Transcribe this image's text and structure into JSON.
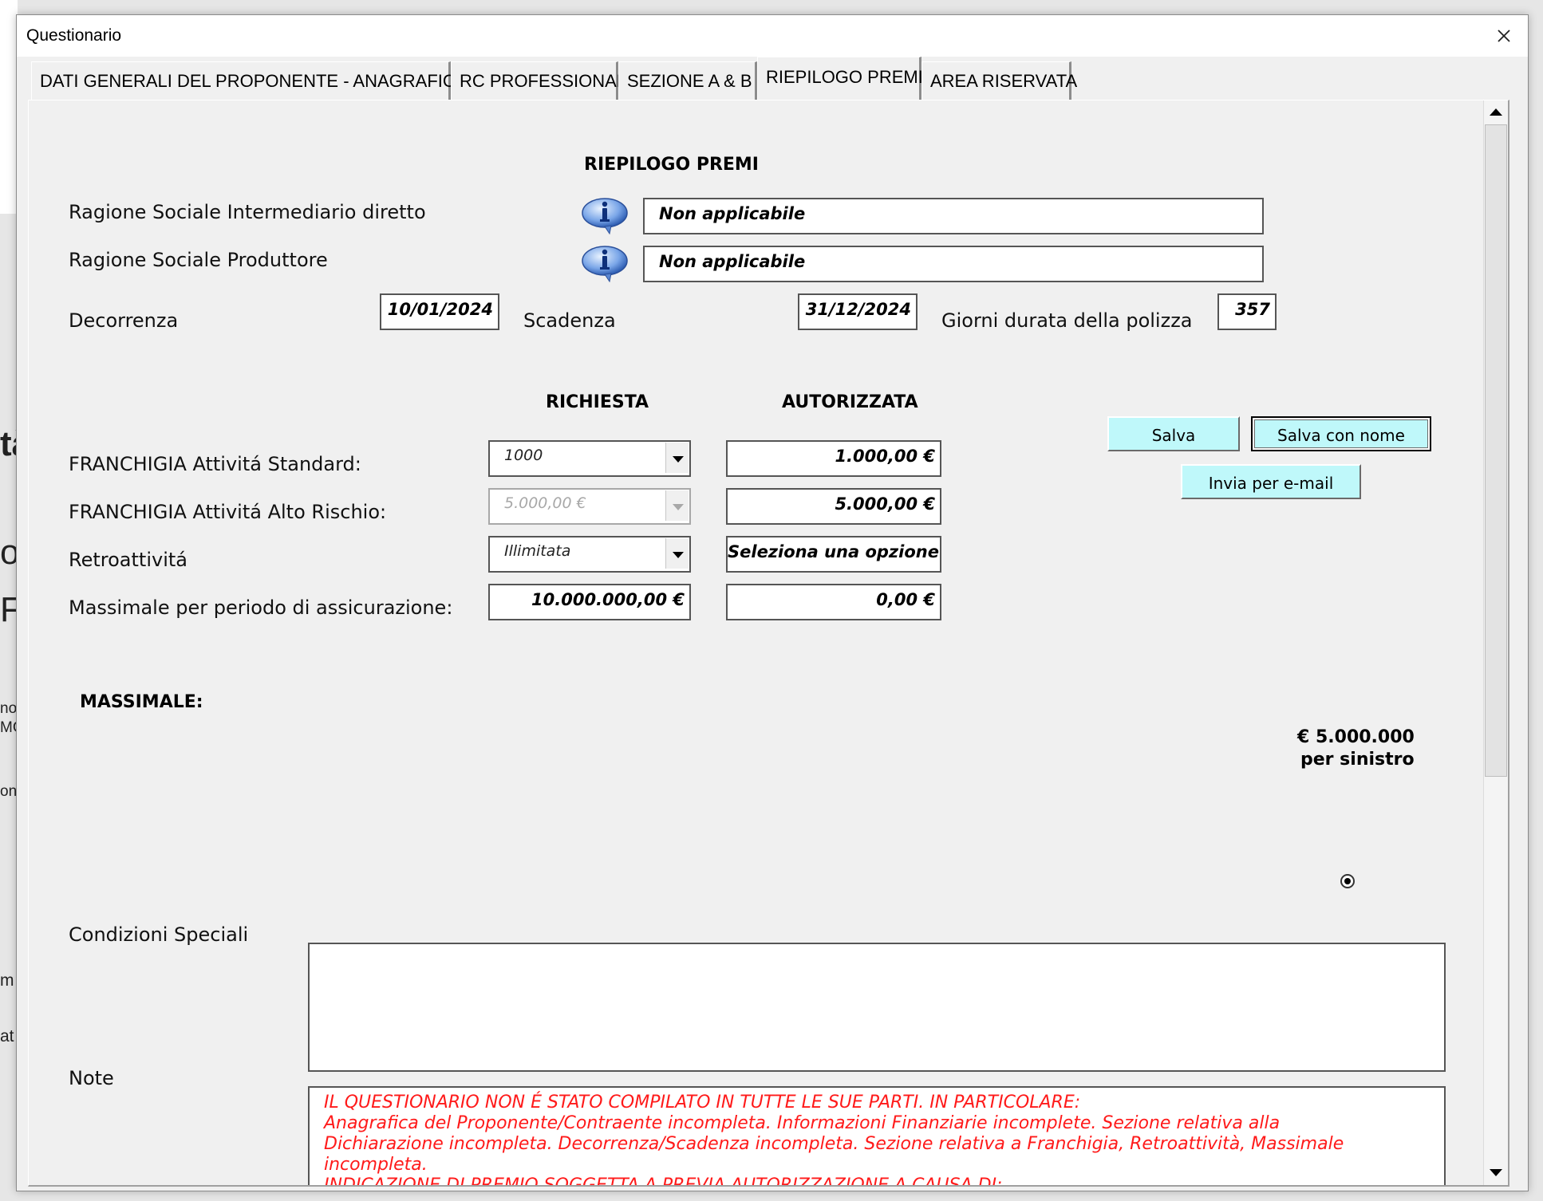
{
  "window": {
    "title": "Questionario"
  },
  "tabs": [
    {
      "label": "DATI GENERALI DEL PROPONENTE - ANAGRAFICA"
    },
    {
      "label": "RC PROFESSIONALE"
    },
    {
      "label": "SEZIONE A & B"
    },
    {
      "label": "RIEPILOGO PREMI",
      "active": true
    },
    {
      "label": "AREA RISERVATA"
    }
  ],
  "page": {
    "heading": "RIEPILOGO PREMI",
    "ragione_intermediario": {
      "label": "Ragione Sociale Intermediario diretto",
      "value": "Non applicabile"
    },
    "ragione_produttore": {
      "label": "Ragione Sociale Produttore",
      "value": "Non applicabile"
    },
    "decorrenza": {
      "label": "Decorrenza",
      "value": "10/01/2024"
    },
    "scadenza": {
      "label": "Scadenza",
      "value": "31/12/2024"
    },
    "giorni": {
      "label": "Giorni durata della polizza",
      "value": "357"
    },
    "col_richiesta": "RICHIESTA",
    "col_autorizzata": "AUTORIZZATA",
    "rows": [
      {
        "label": "FRANCHIGIA Attivitá Standard:",
        "richiesta": "1000",
        "autorizzata": "1.000,00 €"
      },
      {
        "label": "FRANCHIGIA Attivitá Alto Rischio:",
        "richiesta": "5.000,00 €",
        "autorizzata": "5.000,00 €"
      },
      {
        "label": "Retroattivitá",
        "richiesta": "Illimitata",
        "autorizzata": "Seleziona una opzione"
      },
      {
        "label": "Massimale per periodo di assicurazione:",
        "richiesta": "10.000.000,00 €",
        "autorizzata": "0,00 €"
      }
    ],
    "buttons": {
      "salva": "Salva",
      "salva_con_nome": "Salva con nome",
      "invia_email": "Invia per e-mail"
    },
    "massimale": {
      "label": "MASSIMALE:",
      "option_amount": "€ 5.000.000",
      "option_unit": "per sinistro",
      "selected": true
    },
    "condizioni": {
      "label": "Condizioni Speciali",
      "value": ""
    },
    "note": {
      "label": "Note",
      "lines": [
        "IL QUESTIONARIO NON É STATO COMPILATO IN TUTTE LE SUE PARTI. IN PARTICOLARE:",
        "Anagrafica del Proponente/Contraente incompleta. Informazioni Finanziarie incomplete. Sezione relativa alla",
        "Dichiarazione incompleta. Decorrenza/Scadenza incompleta. Sezione relativa a Franchigia, Retroattività, Massimale",
        "incompleta.",
        "INDICAZIONE DI PREMIO SOGGETTA A PREVIA AUTORIZZAZIONE A CAUSA DI:"
      ],
      "color": "#ff1a1a"
    }
  },
  "background_fragments": [
    "tà",
    "o",
    "F",
    "no",
    "MC",
    "oni",
    "m",
    "at"
  ],
  "colors": {
    "button_bg": "#bff8fa",
    "window_bg": "#f0f0f0"
  },
  "icons": {
    "info": "info-speech-bubble-icon",
    "close": "close-icon"
  }
}
